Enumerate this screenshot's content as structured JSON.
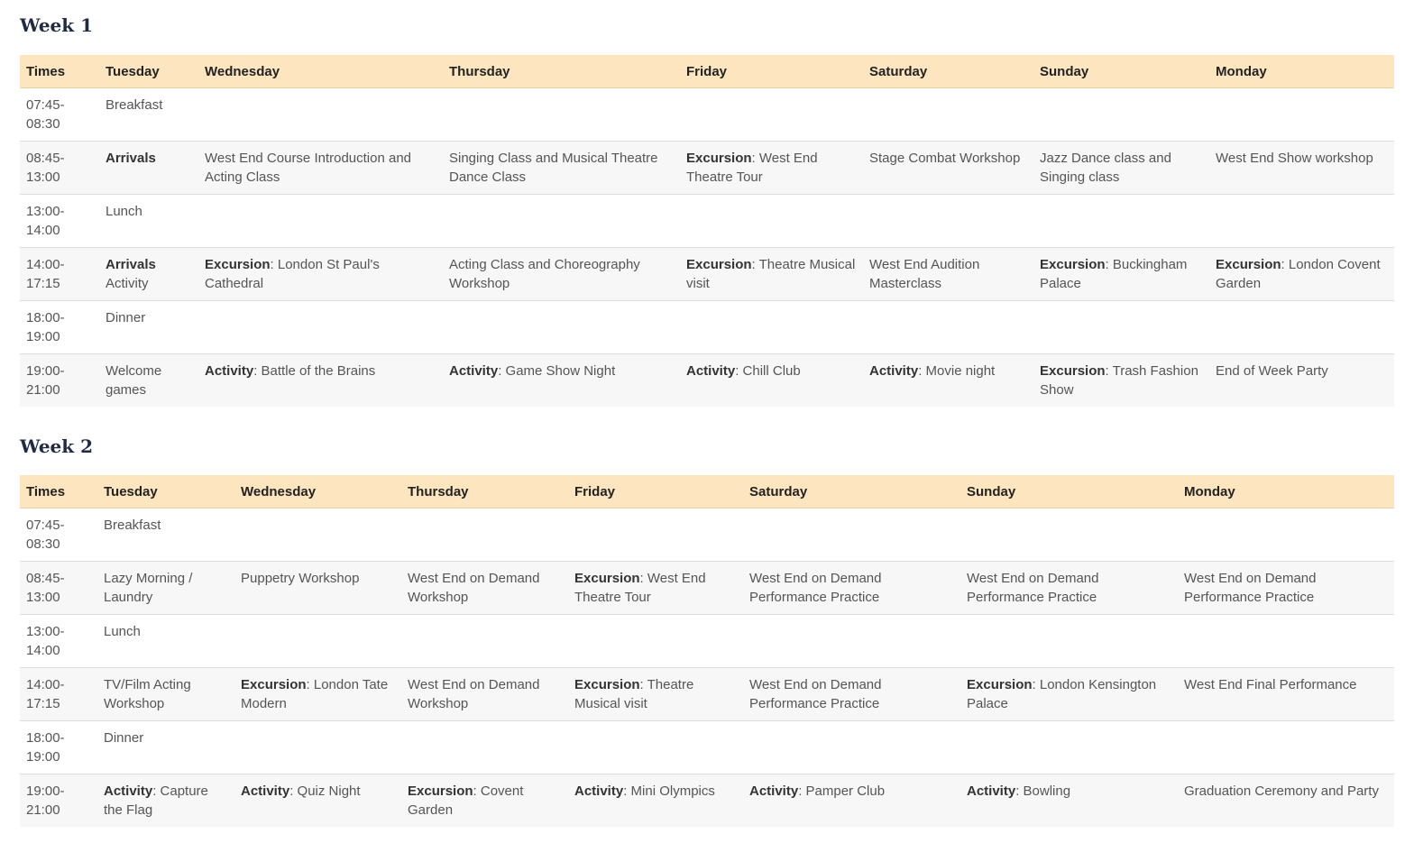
{
  "week1": {
    "title": "Week 1",
    "headers": [
      "Times",
      "Tuesday",
      "Wednesday",
      "Thursday",
      "Friday",
      "Saturday",
      "Sunday",
      "Monday"
    ],
    "rows": [
      [
        {
          "text": "07:45-\n08:30"
        },
        {
          "text": "Breakfast"
        },
        {
          "text": ""
        },
        {
          "text": ""
        },
        {
          "text": ""
        },
        {
          "text": ""
        },
        {
          "text": ""
        },
        {
          "text": ""
        }
      ],
      [
        {
          "text": "08:45-\n13:00"
        },
        {
          "bold": "Arrivals"
        },
        {
          "text": "West End Course Introduction and Acting Class"
        },
        {
          "text": "Singing Class and Musical Theatre Dance Class"
        },
        {
          "bold": "Excursion",
          "text": ": West End Theatre Tour"
        },
        {
          "text": "Stage Combat Workshop"
        },
        {
          "text": "Jazz Dance class and Singing class"
        },
        {
          "text": "West End Show workshop"
        }
      ],
      [
        {
          "text": "13:00-\n14:00"
        },
        {
          "text": "Lunch"
        },
        {
          "text": ""
        },
        {
          "text": ""
        },
        {
          "text": ""
        },
        {
          "text": ""
        },
        {
          "text": ""
        },
        {
          "text": ""
        }
      ],
      [
        {
          "text": "14:00-\n17:15"
        },
        {
          "bold": "Arrivals",
          "text": "\nActivity"
        },
        {
          "bold": "Excursion",
          "text": ": London St Paul's Cathedral"
        },
        {
          "text": "Acting Class and Choreography Workshop"
        },
        {
          "bold": "Excursion",
          "text": ": Theatre Musical visit"
        },
        {
          "text": "West End Audition Masterclass"
        },
        {
          "bold": "Excursion",
          "text": ": Buckingham Palace"
        },
        {
          "bold": "Excursion",
          "text": ": London Covent Garden"
        }
      ],
      [
        {
          "text": "18:00-\n19:00"
        },
        {
          "text": "Dinner"
        },
        {
          "text": ""
        },
        {
          "text": ""
        },
        {
          "text": ""
        },
        {
          "text": ""
        },
        {
          "text": ""
        },
        {
          "text": ""
        }
      ],
      [
        {
          "text": "19:00-\n21:00"
        },
        {
          "text": "Welcome games"
        },
        {
          "bold": "Activity",
          "text": ": Battle of the Brains"
        },
        {
          "bold": "Activity",
          "text": ": Game Show Night"
        },
        {
          "bold": "Activity",
          "text": ": Chill Club"
        },
        {
          "bold": "Activity",
          "text": ": Movie night"
        },
        {
          "bold": "Excursion",
          "text": ": Trash Fashion Show"
        },
        {
          "text": "End of Week Party"
        }
      ]
    ]
  },
  "week2": {
    "title": "Week 2",
    "headers": [
      "Times",
      "Tuesday",
      "Wednesday",
      "Thursday",
      "Friday",
      "Saturday",
      "Sunday",
      "Monday"
    ],
    "rows": [
      [
        {
          "text": "07:45-\n08:30"
        },
        {
          "text": "Breakfast"
        },
        {
          "text": ""
        },
        {
          "text": ""
        },
        {
          "text": ""
        },
        {
          "text": ""
        },
        {
          "text": ""
        },
        {
          "text": ""
        }
      ],
      [
        {
          "text": "08:45-\n13:00"
        },
        {
          "text": "Lazy Morning / Laundry"
        },
        {
          "text": "Puppetry Workshop"
        },
        {
          "text": "West End on Demand Workshop"
        },
        {
          "bold": "Excursion",
          "text": ": West End Theatre Tour"
        },
        {
          "text": "West End on Demand Performance Practice"
        },
        {
          "text": "West End on Demand Performance Practice"
        },
        {
          "text": "West End on Demand Performance Practice"
        }
      ],
      [
        {
          "text": "13:00-\n14:00"
        },
        {
          "text": "Lunch"
        },
        {
          "text": ""
        },
        {
          "text": ""
        },
        {
          "text": ""
        },
        {
          "text": ""
        },
        {
          "text": ""
        },
        {
          "text": ""
        }
      ],
      [
        {
          "text": "14:00-\n17:15"
        },
        {
          "text": "TV/Film Acting Workshop"
        },
        {
          "bold": "Excursion",
          "text": ": London Tate Modern"
        },
        {
          "text": "West End on Demand Workshop"
        },
        {
          "bold": "Excursion",
          "text": ": Theatre Musical visit"
        },
        {
          "text": "West End on Demand Performance Practice"
        },
        {
          "bold": "Excursion",
          "text": ": London Kensington Palace"
        },
        {
          "text": "West End Final Performance"
        }
      ],
      [
        {
          "text": "18:00-\n19:00"
        },
        {
          "text": "Dinner"
        },
        {
          "text": ""
        },
        {
          "text": ""
        },
        {
          "text": ""
        },
        {
          "text": ""
        },
        {
          "text": ""
        },
        {
          "text": ""
        }
      ],
      [
        {
          "text": "19:00-\n21:00"
        },
        {
          "bold": "Activity",
          "text": ": Capture the Flag"
        },
        {
          "bold": "Activity",
          "text": ": Quiz Night"
        },
        {
          "bold": "Excursion",
          "text": ": Covent Garden"
        },
        {
          "bold": "Activity",
          "text": ": Mini Olympics"
        },
        {
          "bold": "Activity",
          "text": ": Pamper Club"
        },
        {
          "bold": "Activity",
          "text": ": Bowling"
        },
        {
          "text": "Graduation Ceremony and Party"
        }
      ]
    ]
  }
}
